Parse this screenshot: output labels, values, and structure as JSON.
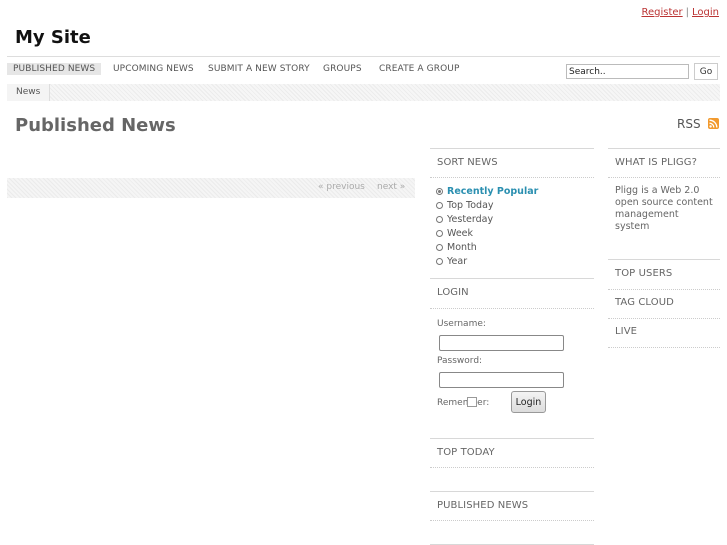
{
  "header": {
    "register_link": "Register",
    "separator": "|",
    "login_link": "Login",
    "site_title": "My Site"
  },
  "nav": {
    "items": [
      {
        "label": "PUBLISHED NEWS",
        "active": true
      },
      {
        "label": "UPCOMING NEWS",
        "active": false
      },
      {
        "label": "SUBMIT A NEW STORY",
        "active": false
      },
      {
        "label": "GROUPS",
        "active": false
      },
      {
        "label": "CREATE A GROUP",
        "active": false
      }
    ],
    "search_value": "Search..",
    "go_label": "Go"
  },
  "breadcrumb": {
    "label": "News"
  },
  "main": {
    "heading": "Published News",
    "rss_label": "RSS",
    "pager": {
      "previous": "« previous",
      "next": "next »"
    }
  },
  "sidebar_mid": {
    "sort_news": {
      "title": "SORT NEWS",
      "options": [
        {
          "label": "Recently Popular",
          "selected": true
        },
        {
          "label": "Top Today",
          "selected": false
        },
        {
          "label": "Yesterday",
          "selected": false
        },
        {
          "label": "Week",
          "selected": false
        },
        {
          "label": "Month",
          "selected": false
        },
        {
          "label": "Year",
          "selected": false
        }
      ]
    },
    "login_box": {
      "title": "LOGIN",
      "username_label": "Username:",
      "username_value": "",
      "password_label": "Password:",
      "password_value": "",
      "remember_label": "Remember:",
      "remember_checked": false,
      "login_button": "Login"
    },
    "top_today_title": "TOP TODAY",
    "published_news_title": "PUBLISHED NEWS"
  },
  "sidebar_right": {
    "what_is_title": "WHAT IS PLIGG?",
    "what_is_text": "Pligg is a Web 2.0 open source content management system",
    "top_users_title": "TOP USERS",
    "tag_cloud_title": "TAG CLOUD",
    "live_title": "LIVE"
  },
  "colors": {
    "link_red": "#b33333",
    "active_sort": "#2a8fb0",
    "rss_orange": "#f29a2e"
  }
}
